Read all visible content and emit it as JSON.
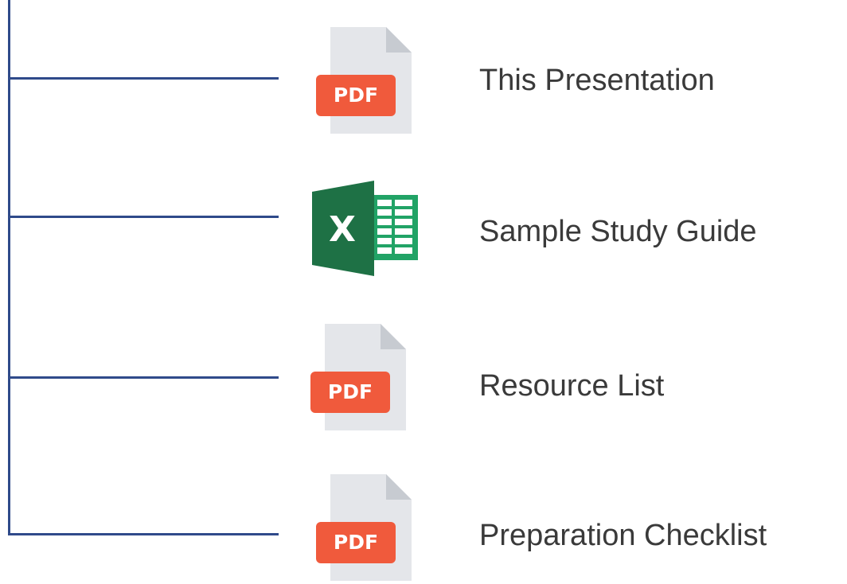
{
  "items": [
    {
      "label": "This Presentation",
      "icon": "pdf-file-icon",
      "badge": "PDF"
    },
    {
      "label": "Sample Study Guide",
      "icon": "excel-file-icon",
      "badge": "X"
    },
    {
      "label": "Resource List",
      "icon": "pdf-file-icon",
      "badge": "PDF"
    },
    {
      "label": "Preparation Checklist",
      "icon": "pdf-file-icon",
      "badge": "PDF"
    }
  ],
  "colors": {
    "connector": "#2f4a8a",
    "pdf_badge": "#f05a3c",
    "file_page": "#e4e6ea",
    "file_fold": "#c7cbd1",
    "excel_dark": "#1e7145",
    "excel_green": "#21a366",
    "label_text": "#3a3a3a"
  }
}
